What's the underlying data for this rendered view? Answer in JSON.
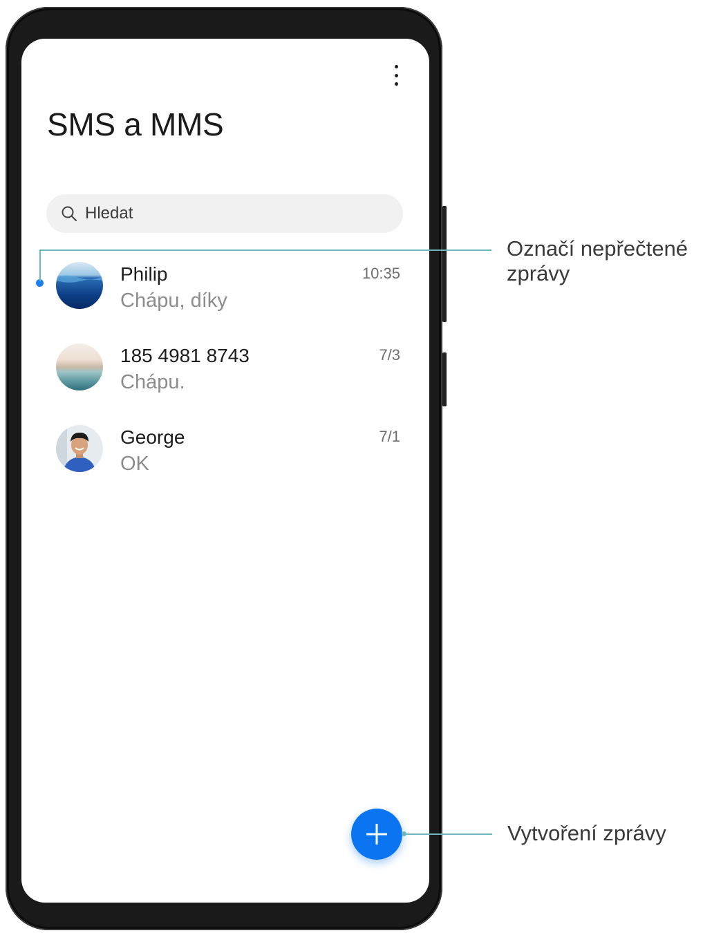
{
  "app": {
    "title": "SMS a MMS",
    "more_icon": "more-vertical-icon"
  },
  "search": {
    "placeholder": "Hledat",
    "icon": "search-icon"
  },
  "conversations": [
    {
      "name": "Philip",
      "preview": "Chápu, díky",
      "time": "10:35",
      "unread": true,
      "avatar": "ocean-photo"
    },
    {
      "name": "185 4981 8743",
      "preview": "Chápu.",
      "time": "7/3",
      "unread": false,
      "avatar": "beach-photo"
    },
    {
      "name": "George",
      "preview": "OK",
      "time": "7/1",
      "unread": false,
      "avatar": "person-photo"
    }
  ],
  "fab": {
    "icon": "plus-icon"
  },
  "callouts": {
    "unread_line1": "Označí nepřečtené",
    "unread_line2": "zprávy",
    "new_message": "Vytvoření zprávy"
  },
  "colors": {
    "accent": "#0b74f0",
    "unread_dot": "#1a7ff0",
    "callout_line": "#6fb7bc"
  }
}
